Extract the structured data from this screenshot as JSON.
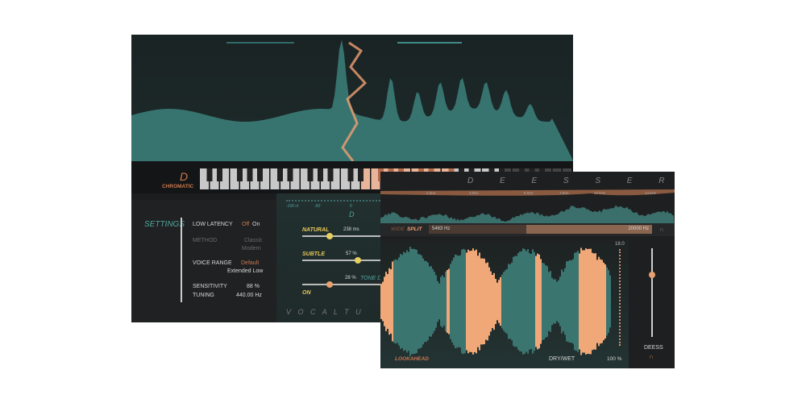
{
  "tuner": {
    "note": "D",
    "scale": "CHROMATIC",
    "settings_title": "SETTINGS",
    "low_latency": {
      "label": "LOW LATENCY",
      "off": "Off",
      "on": "On"
    },
    "method": {
      "label": "METHOD",
      "opt1": "Classic",
      "opt2": "Modern"
    },
    "voice_range": {
      "label": "VOICE RANGE",
      "opt1": "Default",
      "opt2": "Extended Low"
    },
    "sensitivity": {
      "label": "SENSITIVITY",
      "value": "88 %"
    },
    "tuning": {
      "label": "TUNING",
      "value": "440.00 Hz"
    },
    "cents_ticks": [
      "-100 ct",
      "-50",
      "0"
    ],
    "detected_note": "D",
    "natural": {
      "label": "NATURAL",
      "value": "238 ms",
      "fraction": 0.27
    },
    "subtle": {
      "label": "SUBTLE",
      "value": "57 %",
      "fraction": 0.57
    },
    "tone": {
      "label": "ON",
      "value": "28 %",
      "fraction": 0.28,
      "side_label": "TONE D"
    },
    "footer_title": "V O C A L   T U"
  },
  "deesser": {
    "title": "D E E S S E R",
    "freq_ticks": [
      "2 kHz",
      "3 kHz",
      "5 kHz",
      "7 kHz",
      "10 kHz",
      "14 kHz"
    ],
    "mode_wide": "WIDE",
    "mode_split": "SPLIT",
    "split_low": "5463 Hz",
    "split_high": "20000 Hz",
    "meter_max": "18.0",
    "lookahead": "LOOKAHEAD",
    "drywet_label": "DRY/WET",
    "drywet_value": "100 %",
    "deess_label": "DEESS",
    "deess_fraction": 0.8
  },
  "colors": {
    "teal": "#3e7f7b",
    "orange": "#f0a070",
    "yellow": "#e6c85a"
  }
}
